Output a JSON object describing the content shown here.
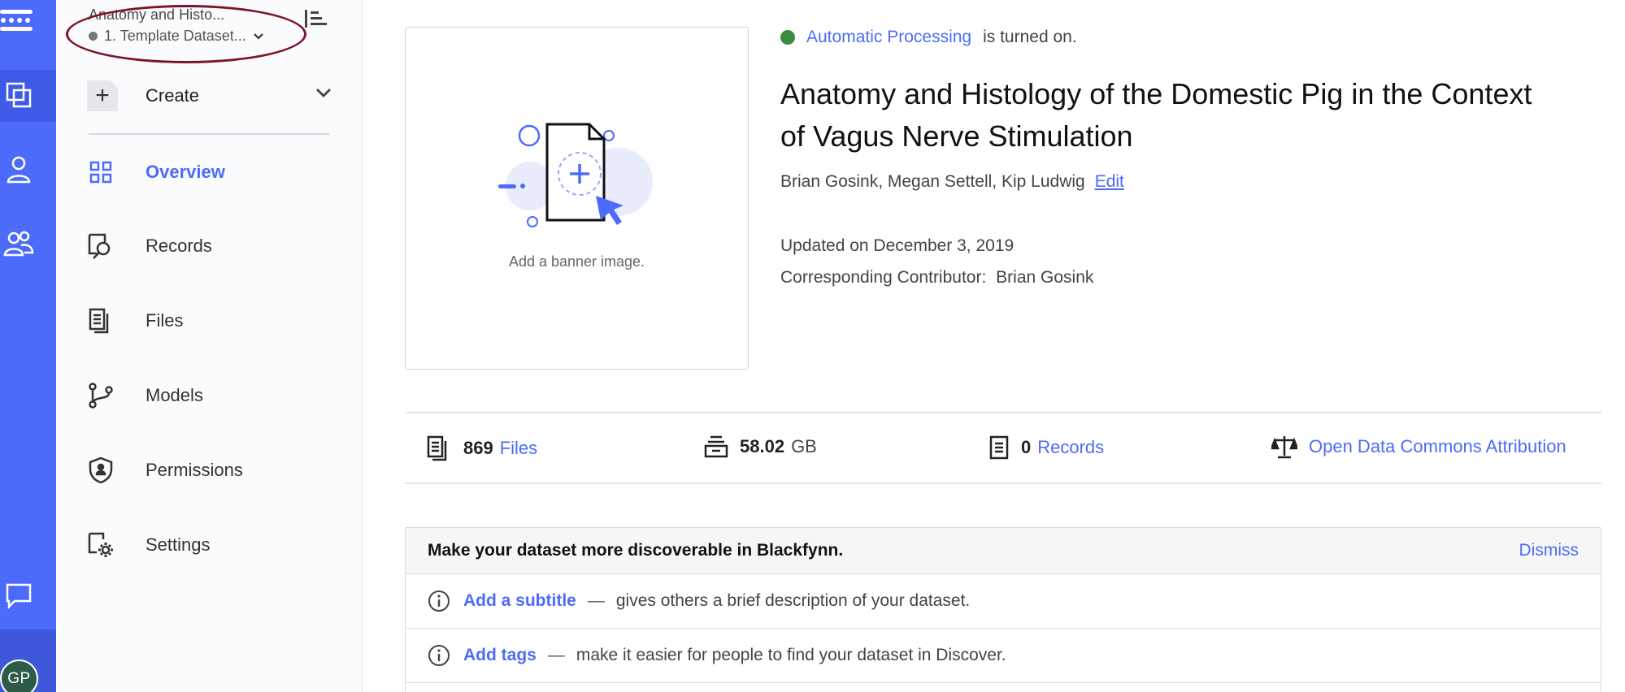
{
  "dataset": {
    "short_title": "Anatomy and Histo...",
    "selector_label": "1. Template Dataset...",
    "full_title": "Anatomy and Histology of the Domestic Pig in the Context of Vagus Nerve Stimulation",
    "authors": "Brian Gosink, Megan Settell, Kip Ludwig",
    "edit_label": "Edit",
    "updated": "Updated on December 3, 2019",
    "contributor_label": "Corresponding Contributor:",
    "contributor_name": "Brian Gosink"
  },
  "processing": {
    "link": "Automatic Processing",
    "text": "is turned on.",
    "status_color": "#3a8b3d"
  },
  "user": {
    "initials": "GP"
  },
  "sidebar": {
    "create_label": "Create",
    "items": [
      {
        "label": "Overview",
        "icon": "grid-icon",
        "active": true
      },
      {
        "label": "Records",
        "icon": "record-search-icon"
      },
      {
        "label": "Files",
        "icon": "files-icon"
      },
      {
        "label": "Models",
        "icon": "models-icon"
      },
      {
        "label": "Permissions",
        "icon": "shield-icon"
      },
      {
        "label": "Settings",
        "icon": "settings-icon"
      }
    ]
  },
  "banner": {
    "caption": "Add a banner image."
  },
  "stats": {
    "files_count": "869",
    "files_label": "Files",
    "size_value": "58.02",
    "size_unit": "GB",
    "records_count": "0",
    "records_label": "Records",
    "license": "Open Data Commons Attribution"
  },
  "discover": {
    "heading": "Make your dataset more discoverable in Blackfynn.",
    "dismiss": "Dismiss",
    "rows": [
      {
        "link": "Add a subtitle",
        "dash": "—",
        "desc": "gives others a brief description of your dataset."
      },
      {
        "link": "Add tags",
        "dash": "—",
        "desc": "make it easier for people to find your dataset in Discover."
      }
    ]
  },
  "colors": {
    "accent": "#4d6bfa",
    "rail": "#4d6bfa",
    "annotation": "#7d1424"
  }
}
